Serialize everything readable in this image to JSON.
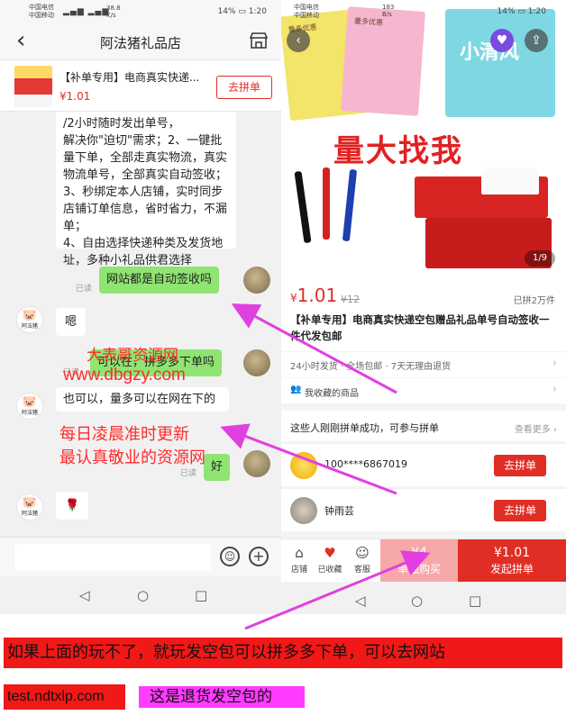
{
  "left": {
    "status": {
      "carrier1": "中国电信",
      "carrier2": "中国移动",
      "speed": "38.8",
      "speed_unit": "K/s",
      "battery": "14%",
      "time": "1:20"
    },
    "shop_title": "阿法猪礼品店",
    "product": {
      "name": "【补单专用】电商真实快递...",
      "price": "¥1.01",
      "button": "去拼单"
    },
    "messages": {
      "long_text": "/2小时随时发出单号，\n解决你\"迫切\"需求；2、一键批量下单，全部走真实物流，真实物流单号，全部真实自动签收；3、秒绑定本人店铺，实时同步店铺订单信息，省时省力，不漏单；\n4、自由选择快递种类及发货地址，多种小礼品供君选择",
      "read_label": "已读",
      "m_auto_sign": "网站都是自动签收吗",
      "m_en": "嗯",
      "m_can_order": "可以在，拼多多下单吗",
      "m_yes": "也可以，量多可以在网在下的",
      "m_ok": "好",
      "m_rose": "🌹"
    },
    "avatar_name": "阿法猪"
  },
  "right": {
    "status": {
      "carrier1": "中国电信",
      "carrier2": "中国移动",
      "speed": "183",
      "speed_unit": "B/s",
      "battery": "14%",
      "time": "1:20"
    },
    "hero": {
      "slogan": "量大找我",
      "pack_text": "量多优惠",
      "pack3_text": "小清风",
      "counter": "1/9"
    },
    "price": {
      "currency": "¥",
      "current": "1.01",
      "original": "¥12",
      "sold": "已拼2万件"
    },
    "title": "【补单专用】电商真实快递空包赠品礼品单号自动签收一件代发包邮",
    "services": "24小时发货 · 全场包邮 · 7天无理由退货",
    "favorites": "我收藏的商品",
    "group_header": "这些人刚刚拼单成功，可参与拼单",
    "see_more": "查看更多 ›",
    "groups": [
      {
        "name": "100****6867019",
        "button": "去拼单"
      },
      {
        "name": "钟雨芸",
        "button": "去拼单"
      }
    ],
    "bottom": {
      "store": "店铺",
      "fav": "已收藏",
      "service": "客服",
      "solo_price": "¥4",
      "solo_label": "单独购买",
      "group_price": "¥1.01",
      "group_label": "发起拼单"
    }
  },
  "overlay": {
    "line1": "大表哥资源网",
    "line2": "www.dbgzy.com",
    "line3": "每日凌晨准时更新",
    "line4": "最认真敬业的资源网"
  },
  "banner": {
    "line1": "如果上面的玩不了，就玩发空包可以拼多多下单，可以去网站",
    "site": "test.ndtxlp.com",
    "note": "这是退货发空包的"
  },
  "colors": {
    "accent": "#e02e24",
    "chat_green": "#8fe472",
    "overlay_red": "#ff2a2a",
    "arrow_magenta": "#e040e0",
    "banner_red": "#f11818",
    "banner_pink": "#ff3bff"
  }
}
